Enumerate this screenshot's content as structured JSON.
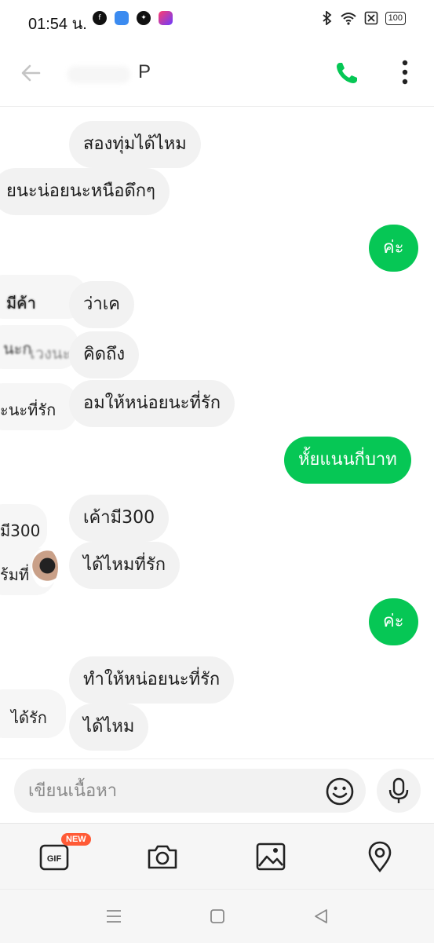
{
  "status_bar": {
    "time": "01:54 น.",
    "battery": "100"
  },
  "header": {
    "contact_name": "P"
  },
  "messages": [
    {
      "side": "in",
      "text": "สองทุ่มได้ไหม"
    },
    {
      "side": "in_partial",
      "text": "ยนะน่อยนะหนือดึกๆ"
    },
    {
      "side": "out",
      "text": "ค่ะ"
    },
    {
      "side": "in",
      "text": "ว่าเค"
    },
    {
      "side": "in",
      "text": "คิดถึง"
    },
    {
      "side": "in",
      "text": "อมให้หน่อยนะที่รัก"
    },
    {
      "side": "out",
      "text": "หั้ยแนนกี่บาท"
    },
    {
      "side": "in",
      "text": "เค้ามี300"
    },
    {
      "side": "in",
      "text": "ได้ไหมที่รัก"
    },
    {
      "side": "out",
      "text": "ค่ะ"
    },
    {
      "side": "in",
      "text": "ทำให้หน่อยนะที่รัก"
    },
    {
      "side": "in",
      "text": "ได้ไหม"
    }
  ],
  "ghost_texts": [
    "มีค้า",
    "นะก",
    "ะนะที่รัก",
    "มี300",
    "ร้มที่",
    "ได้รัก",
    "เวงนะ"
  ],
  "composer": {
    "placeholder": "เขียนเนื้อหา"
  },
  "attachments": {
    "gif_badge": "NEW",
    "gif_label": "GIF"
  },
  "colors": {
    "accent": "#06c755",
    "incoming_bubble": "#f2f2f2"
  },
  "icons": [
    "back-arrow-icon",
    "phone-icon",
    "more-vertical-icon",
    "emoji-icon",
    "microphone-icon",
    "gif-icon",
    "camera-icon",
    "image-icon",
    "location-icon"
  ]
}
